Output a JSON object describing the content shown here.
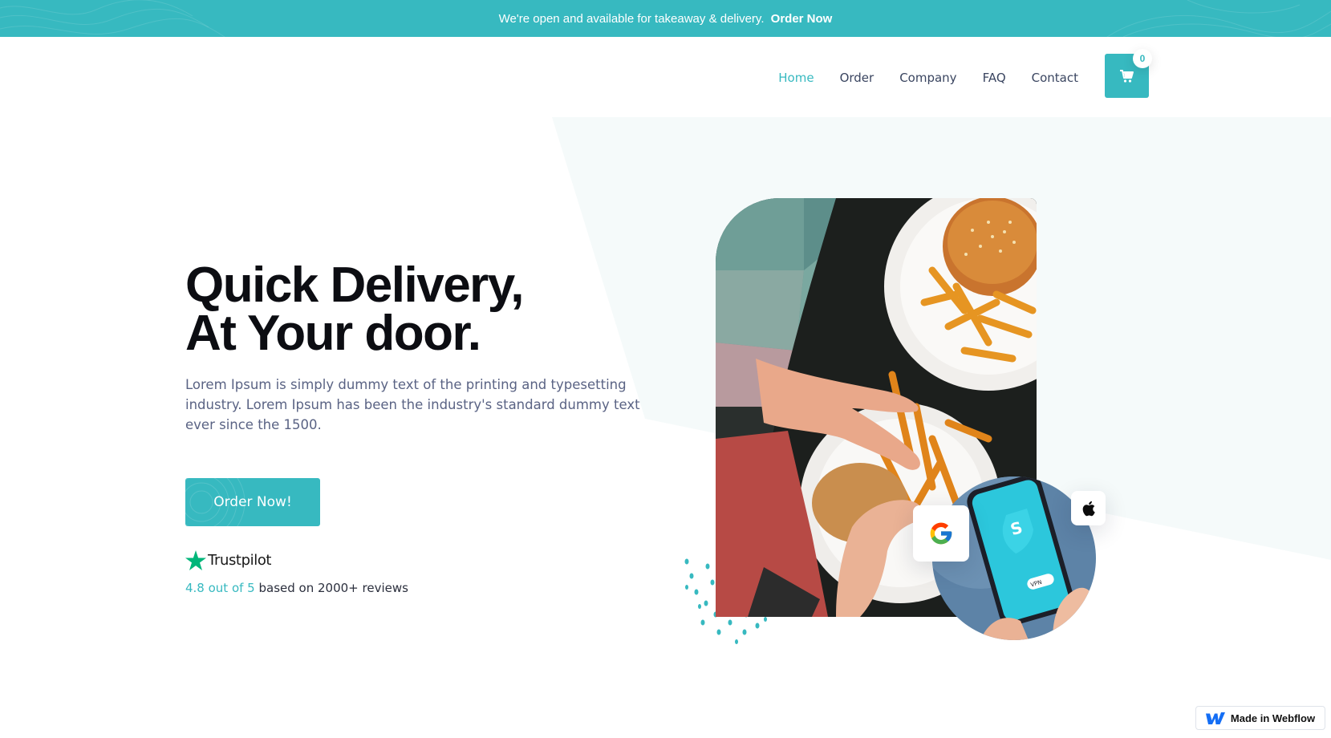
{
  "announcement": {
    "text": "We're open and available for takeaway & delivery.",
    "link": "Order Now"
  },
  "nav": {
    "items": [
      {
        "label": "Home",
        "active": true
      },
      {
        "label": "Order",
        "active": false
      },
      {
        "label": "Company",
        "active": false
      },
      {
        "label": "FAQ",
        "active": false
      },
      {
        "label": "Contact",
        "active": false
      }
    ],
    "cart_count": "0"
  },
  "hero": {
    "title_line1": "Quick Delivery,",
    "title_line2": "At Your door.",
    "description": "Lorem Ipsum is simply dummy text of the printing and typesetting industry. Lorem Ipsum has been the industry's standard dummy text ever since the 1500.",
    "cta_label": "Order Now!",
    "trustpilot": {
      "brand": "Trustpilot",
      "score_text": "4.8 out of 5",
      "suffix_text": " based on 2000+ reviews"
    },
    "phone_screen_label": "VPN"
  },
  "footer_badge": {
    "label": "Made in Webflow"
  },
  "colors": {
    "accent": "#37b9c0",
    "hero_shape": "#f5fafa",
    "heading": "#0c0d12",
    "body_text": "#5a6384",
    "trustpilot_green": "#00b67a"
  },
  "icons": [
    "cart-icon",
    "trustpilot-star-icon",
    "google-icon",
    "apple-icon",
    "webflow-logo-icon"
  ]
}
